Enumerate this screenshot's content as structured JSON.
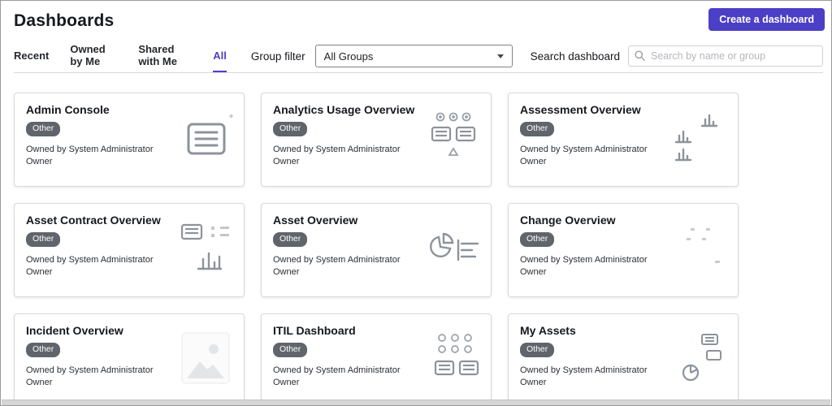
{
  "page": {
    "title": "Dashboards"
  },
  "header": {
    "create_button_label": "Create a dashboard"
  },
  "tabs": [
    {
      "label": "Recent",
      "active": false
    },
    {
      "label": "Owned by Me",
      "active": false
    },
    {
      "label": "Shared with Me",
      "active": false
    },
    {
      "label": "All",
      "active": true
    }
  ],
  "filters": {
    "group_filter_label": "Group filter",
    "group_filter_value": "All Groups",
    "search_label": "Search dashboard",
    "search_placeholder": "Search by name or group"
  },
  "colors": {
    "accent": "#4b3fc6",
    "active_tab": "#4a41c8",
    "badge": "#60646b"
  },
  "cards": [
    {
      "title": "Admin Console",
      "badge": "Other",
      "owned_by": "Owned by System Administrator",
      "owner": "Owner",
      "thumbnail": "report-list"
    },
    {
      "title": "Analytics Usage Overview",
      "badge": "Other",
      "owned_by": "Owned by System Administrator",
      "owner": "Owner",
      "thumbnail": "multi-widgets"
    },
    {
      "title": "Assessment Overview",
      "badge": "Other",
      "owned_by": "Owned by System Administrator",
      "owner": "Owner",
      "thumbnail": "bar-charts"
    },
    {
      "title": "Asset Contract Overview",
      "badge": "Other",
      "owned_by": "Owned by System Administrator",
      "owner": "Owner",
      "thumbnail": "list-bars"
    },
    {
      "title": "Asset Overview",
      "badge": "Other",
      "owned_by": "Owned by System Administrator",
      "owner": "Owner",
      "thumbnail": "pie-bars"
    },
    {
      "title": "Change Overview",
      "badge": "Other",
      "owned_by": "Owned by System Administrator",
      "owner": "Owner",
      "thumbnail": "dots"
    },
    {
      "title": "Incident Overview",
      "badge": "Other",
      "owned_by": "Owned by System Administrator",
      "owner": "Owner",
      "thumbnail": "image-placeholder"
    },
    {
      "title": "ITIL Dashboard",
      "badge": "Other",
      "owned_by": "Owned by System Administrator",
      "owner": "Owner",
      "thumbnail": "grid-icons"
    },
    {
      "title": "My Assets",
      "badge": "Other",
      "owned_by": "Owned by System Administrator",
      "owner": "Owner",
      "thumbnail": "mixed-icons"
    }
  ]
}
